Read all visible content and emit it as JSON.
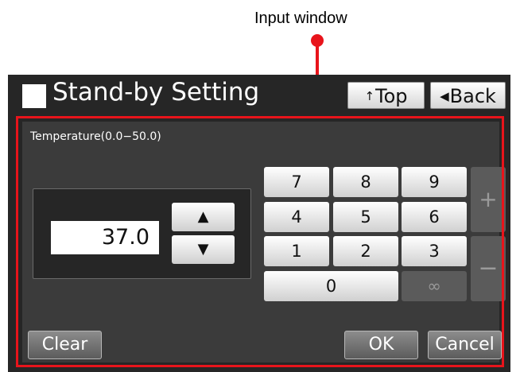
{
  "callout": {
    "label": "Input window"
  },
  "header": {
    "title": "Stand-by Setting",
    "top_label": "Top",
    "back_label": "Back"
  },
  "input": {
    "range_label": "Temperature(0.0−50.0)",
    "value": "37.0",
    "up_symbol": "▲",
    "down_symbol": "▼"
  },
  "keypad": {
    "keys": [
      "7",
      "8",
      "9",
      "4",
      "5",
      "6",
      "1",
      "2",
      "3",
      "0",
      "∞"
    ],
    "plus": "+",
    "minus": "−"
  },
  "footer": {
    "clear_label": "Clear",
    "ok_label": "OK",
    "cancel_label": "Cancel"
  },
  "colors": {
    "highlight": "#e8141b",
    "panel": "#3b3b3b",
    "frame": "#262626"
  }
}
